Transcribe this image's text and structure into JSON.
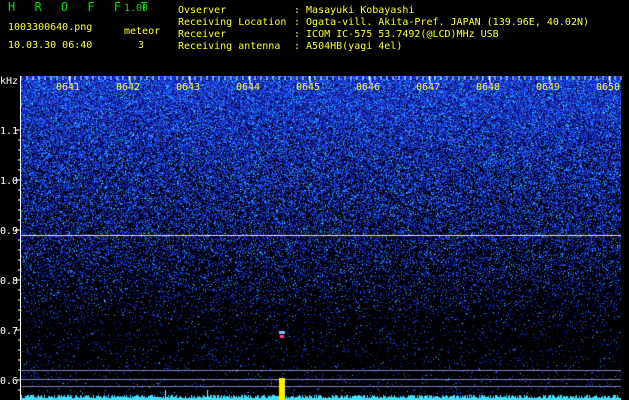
{
  "header": {
    "app_title": "H R O F F T",
    "version": "1.00",
    "filename": "1003300640.png",
    "datetime": "10.03.30 06:40",
    "meteor_label": "meteor",
    "meteor_count": "3",
    "fields": [
      {
        "label": "Ovserver",
        "value": ": Masayuki Kobayashi"
      },
      {
        "label": "Receiving Location",
        "value": ": Ogata-vill. Akita-Pref. JAPAN (139.96E, 40.02N)"
      },
      {
        "label": "Receiver",
        "value": ": ICOM IC-575 53.7492(@LCD)MHz USB"
      },
      {
        "label": "Receiving antenna",
        "value": ": A504HB(yagi 4el)"
      }
    ]
  },
  "spectrogram": {
    "y_unit": "kHz",
    "y_ticks": [
      "1.1",
      "1.0",
      "0.9",
      "0.8",
      "0.7",
      "0.6"
    ],
    "time_labels": [
      "0641",
      "0642",
      "0643",
      "0644",
      "0645",
      "0646",
      "0647",
      "0648",
      "0649",
      "0650"
    ],
    "colors": {
      "noise_high": "#2a5cff",
      "noise_low": "#1a1a80",
      "carrier_line": "#e6e68c",
      "axis": "#ffffff",
      "time_label": "#ffff33"
    }
  }
}
